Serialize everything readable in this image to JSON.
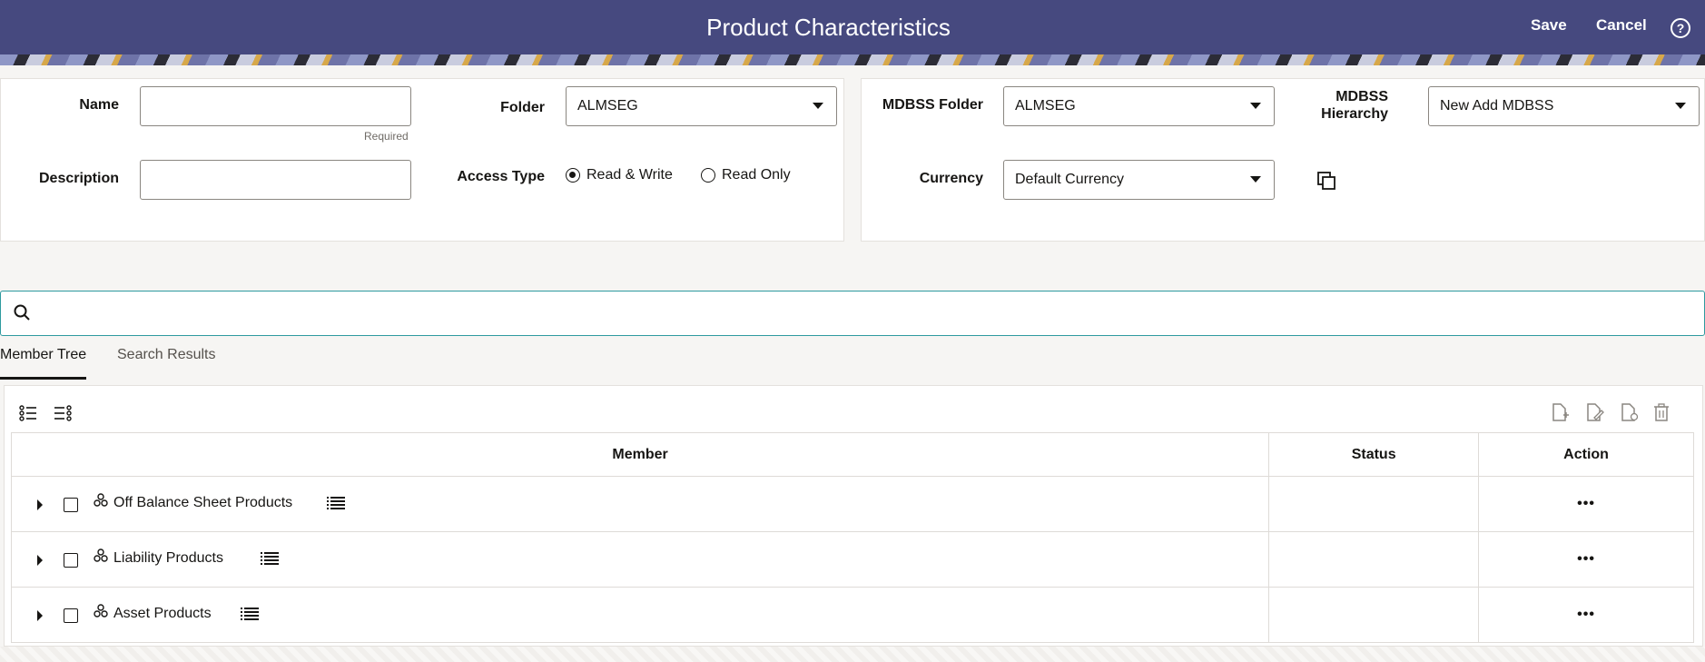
{
  "header": {
    "title": "Product Characteristics",
    "save_label": "Save",
    "cancel_label": "Cancel",
    "help_symbol": "?"
  },
  "left_panel": {
    "name_label": "Name",
    "name_value": "",
    "name_hint": "Required",
    "folder_label": "Folder",
    "folder_value": "ALMSEG",
    "description_label": "Description",
    "description_value": "",
    "access_type_label": "Access Type",
    "access_options": [
      {
        "label": "Read & Write",
        "selected": true
      },
      {
        "label": "Read Only",
        "selected": false
      }
    ]
  },
  "right_panel": {
    "mdbss_folder_label": "MDBSS Folder",
    "mdbss_folder_value": "ALMSEG",
    "mdbss_hierarchy_label_1": "MDBSS",
    "mdbss_hierarchy_label_2": "Hierarchy",
    "mdbss_hierarchy_value": "New Add MDBSS",
    "currency_label": "Currency",
    "currency_value": "Default Currency"
  },
  "search": {
    "value": "",
    "placeholder": ""
  },
  "tabs": [
    {
      "label": "Member Tree",
      "active": true
    },
    {
      "label": "Search Results",
      "active": false
    }
  ],
  "table": {
    "columns": [
      "Member",
      "Status",
      "Action"
    ],
    "rows": [
      {
        "member": "Off Balance Sheet Products",
        "status": "",
        "action": "•••"
      },
      {
        "member": "Liability Products",
        "status": "",
        "action": "•••"
      },
      {
        "member": "Asset Products",
        "status": "",
        "action": "•••"
      }
    ]
  },
  "colors": {
    "header_bg": "#46497f",
    "search_border": "#2e9a9f"
  }
}
